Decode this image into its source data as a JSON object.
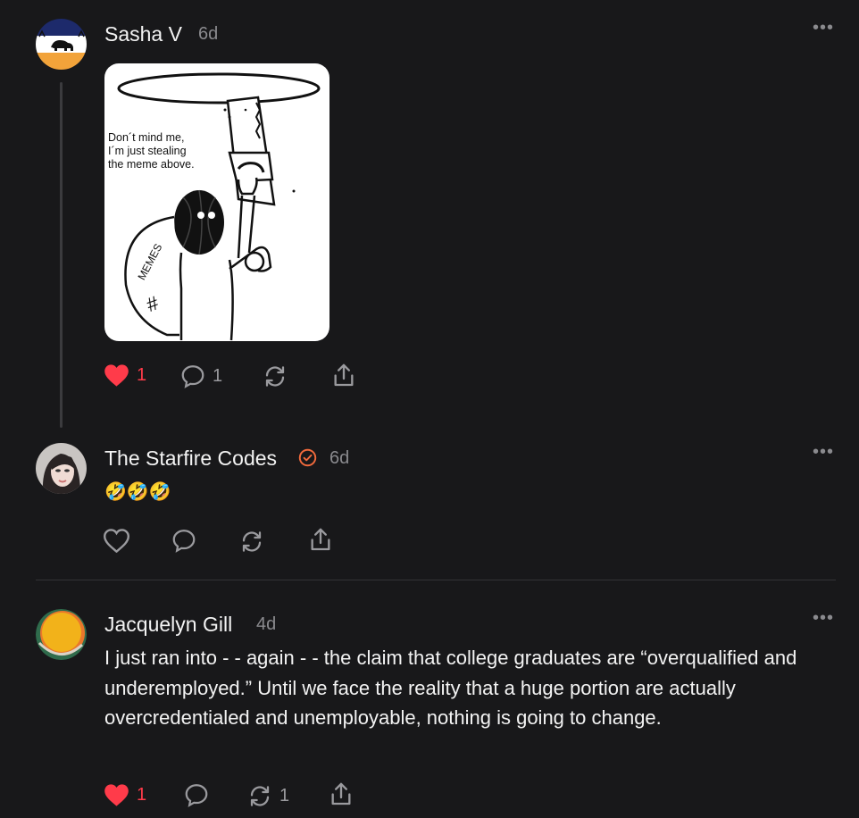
{
  "posts": [
    {
      "author": "Sasha V",
      "time": "6d",
      "image": {
        "caption_lines": [
          "Don´t mind me,",
          "I´m just stealing",
          "the meme above."
        ],
        "bag_label": "MEMES",
        "bag_symbol": "#"
      },
      "actions": {
        "likes": "1",
        "liked": true,
        "replies": "1",
        "reposts": ""
      }
    },
    {
      "author": "The Starfire Codes",
      "verified": true,
      "time": "6d",
      "text": "🤣🤣🤣",
      "actions": {
        "likes": "",
        "liked": false,
        "replies": "",
        "reposts": ""
      }
    },
    {
      "author": "Jacquelyn Gill",
      "time": "4d",
      "text": "I just ran into - - again - - the claim that college graduates are “overqualified and underemployed.” Until we face the reality that a huge portion are actually overcredentialed and unemployable, nothing is going to change.",
      "actions": {
        "likes": "1",
        "liked": true,
        "replies": "",
        "reposts": "1"
      }
    }
  ],
  "icons": [
    "more-icon",
    "heart-icon",
    "comment-icon",
    "repost-icon",
    "share-icon",
    "verified-icon"
  ],
  "colors": {
    "background": "#18181a",
    "like": "#ff3b4a",
    "verified": "#f26a3c",
    "muted": "#8a8a8e"
  }
}
